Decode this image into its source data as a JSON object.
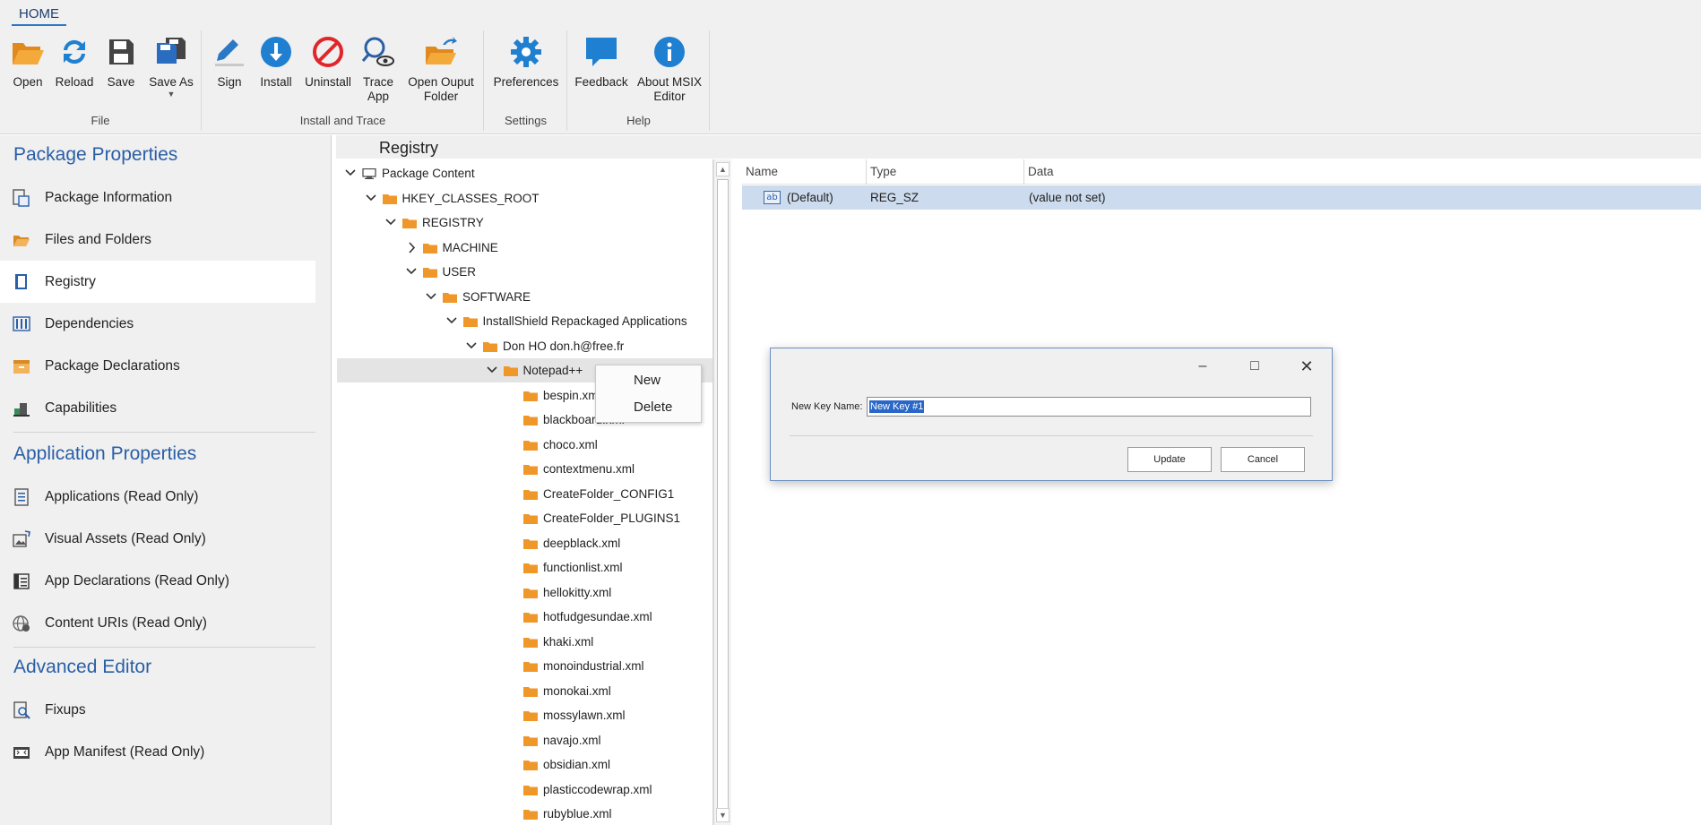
{
  "ribbon": {
    "tab": "HOME",
    "groups": {
      "file": {
        "label": "File",
        "open": "Open",
        "reload": "Reload",
        "save": "Save",
        "save_as": "Save As"
      },
      "install": {
        "label": "Install and Trace",
        "sign": "Sign",
        "install": "Install",
        "uninstall": "Uninstall",
        "trace_l1": "Trace",
        "trace_l2": "App",
        "output_l1": "Open Ouput",
        "output_l2": "Folder"
      },
      "settings": {
        "label": "Settings",
        "preferences": "Preferences"
      },
      "help": {
        "label": "Help",
        "feedback": "Feedback",
        "about_l1": "About MSIX",
        "about_l2": "Editor"
      }
    }
  },
  "nav": {
    "package_title": "Package Properties",
    "package_items": [
      "Package Information",
      "Files and Folders",
      "Registry",
      "Dependencies",
      "Package Declarations",
      "Capabilities"
    ],
    "app_title": "Application Properties",
    "app_items": [
      "Applications (Read Only)",
      "Visual Assets (Read Only)",
      "App Declarations (Read Only)",
      "Content URIs (Read Only)"
    ],
    "adv_title": "Advanced Editor",
    "adv_items": [
      "Fixups",
      "App Manifest (Read Only)"
    ],
    "active": "Registry"
  },
  "registry": {
    "title": "Registry",
    "tree": [
      {
        "label": "Package Content",
        "level": 0,
        "expander": "open",
        "icon": "computer"
      },
      {
        "label": "HKEY_CLASSES_ROOT",
        "level": 1,
        "expander": "open",
        "icon": "folder"
      },
      {
        "label": "REGISTRY",
        "level": 2,
        "expander": "open",
        "icon": "folder"
      },
      {
        "label": "MACHINE",
        "level": 3,
        "expander": "closed",
        "icon": "folder"
      },
      {
        "label": "USER",
        "level": 3,
        "expander": "open",
        "icon": "folder"
      },
      {
        "label": "SOFTWARE",
        "level": 4,
        "expander": "open",
        "icon": "folder"
      },
      {
        "label": "InstallShield Repackaged Applications",
        "level": 5,
        "expander": "open",
        "icon": "folder"
      },
      {
        "label": "Don HO don.h@free.fr",
        "level": 6,
        "expander": "open",
        "icon": "folder"
      },
      {
        "label": "Notepad++",
        "level": 7,
        "expander": "open",
        "icon": "folder",
        "selected": true
      },
      {
        "label": "bespin.xml",
        "level": 8,
        "icon": "folder"
      },
      {
        "label": "blackboard.xml",
        "level": 8,
        "icon": "folder"
      },
      {
        "label": "choco.xml",
        "level": 8,
        "icon": "folder"
      },
      {
        "label": "contextmenu.xml",
        "level": 8,
        "icon": "folder"
      },
      {
        "label": "CreateFolder_CONFIG1",
        "level": 8,
        "icon": "folder"
      },
      {
        "label": "CreateFolder_PLUGINS1",
        "level": 8,
        "icon": "folder"
      },
      {
        "label": "deepblack.xml",
        "level": 8,
        "icon": "folder"
      },
      {
        "label": "functionlist.xml",
        "level": 8,
        "icon": "folder"
      },
      {
        "label": "hellokitty.xml",
        "level": 8,
        "icon": "folder"
      },
      {
        "label": "hotfudgesundae.xml",
        "level": 8,
        "icon": "folder"
      },
      {
        "label": "khaki.xml",
        "level": 8,
        "icon": "folder"
      },
      {
        "label": "monoindustrial.xml",
        "level": 8,
        "icon": "folder"
      },
      {
        "label": "monokai.xml",
        "level": 8,
        "icon": "folder"
      },
      {
        "label": "mossylawn.xml",
        "level": 8,
        "icon": "folder"
      },
      {
        "label": "navajo.xml",
        "level": 8,
        "icon": "folder"
      },
      {
        "label": "obsidian.xml",
        "level": 8,
        "icon": "folder"
      },
      {
        "label": "plasticcodewrap.xml",
        "level": 8,
        "icon": "folder"
      },
      {
        "label": "rubyblue.xml",
        "level": 8,
        "icon": "folder"
      }
    ],
    "columns": {
      "name": "Name",
      "type": "Type",
      "data": "Data"
    },
    "value_row": {
      "name": "(Default)",
      "type": "REG_SZ",
      "data": "(value not set)",
      "icon_text": "ab"
    }
  },
  "context_menu": {
    "new": "New",
    "delete": "Delete"
  },
  "dialog": {
    "label": "New Key Name:",
    "value": "New Key #1",
    "update": "Update",
    "cancel": "Cancel"
  },
  "colors": {
    "accent": "#2a5fa6",
    "folder": "#f0972a",
    "selection": "#ccdbee"
  }
}
